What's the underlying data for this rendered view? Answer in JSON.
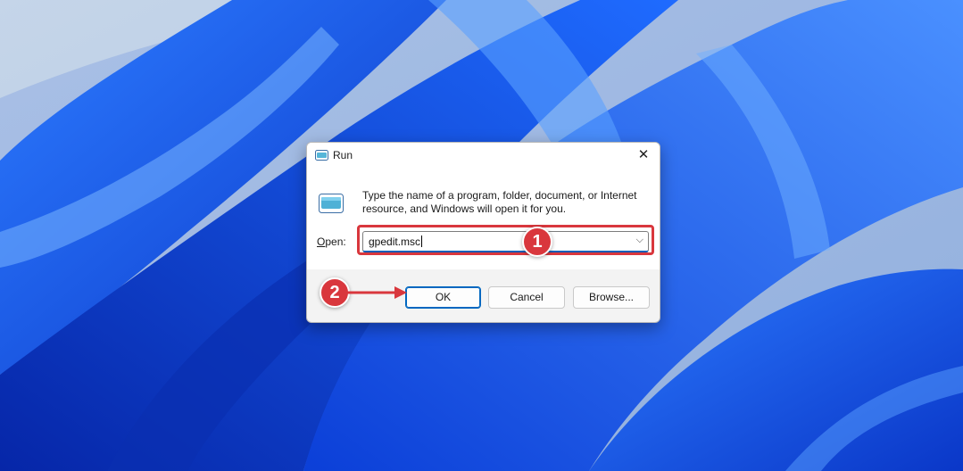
{
  "dialog": {
    "title": "Run",
    "close_glyph": "✕",
    "description": "Type the name of a program, folder, document, or Internet resource, and Windows will open it for you.",
    "open_label_prefix": "O",
    "open_label_rest": "pen:",
    "input_value": "gpedit.msc",
    "dropdown_glyph": "⌵",
    "buttons": {
      "ok": "OK",
      "cancel": "Cancel",
      "browse": "Browse..."
    }
  },
  "annotations": {
    "step1": "1",
    "step2": "2"
  },
  "colors": {
    "accent": "#005fb8",
    "annotation_red": "#d9373d",
    "dialog_bg": "#f3f3f3"
  },
  "icons": [
    "run-app-icon",
    "run-large-icon",
    "close-icon",
    "chevron-down-icon",
    "arrow-right-icon"
  ]
}
